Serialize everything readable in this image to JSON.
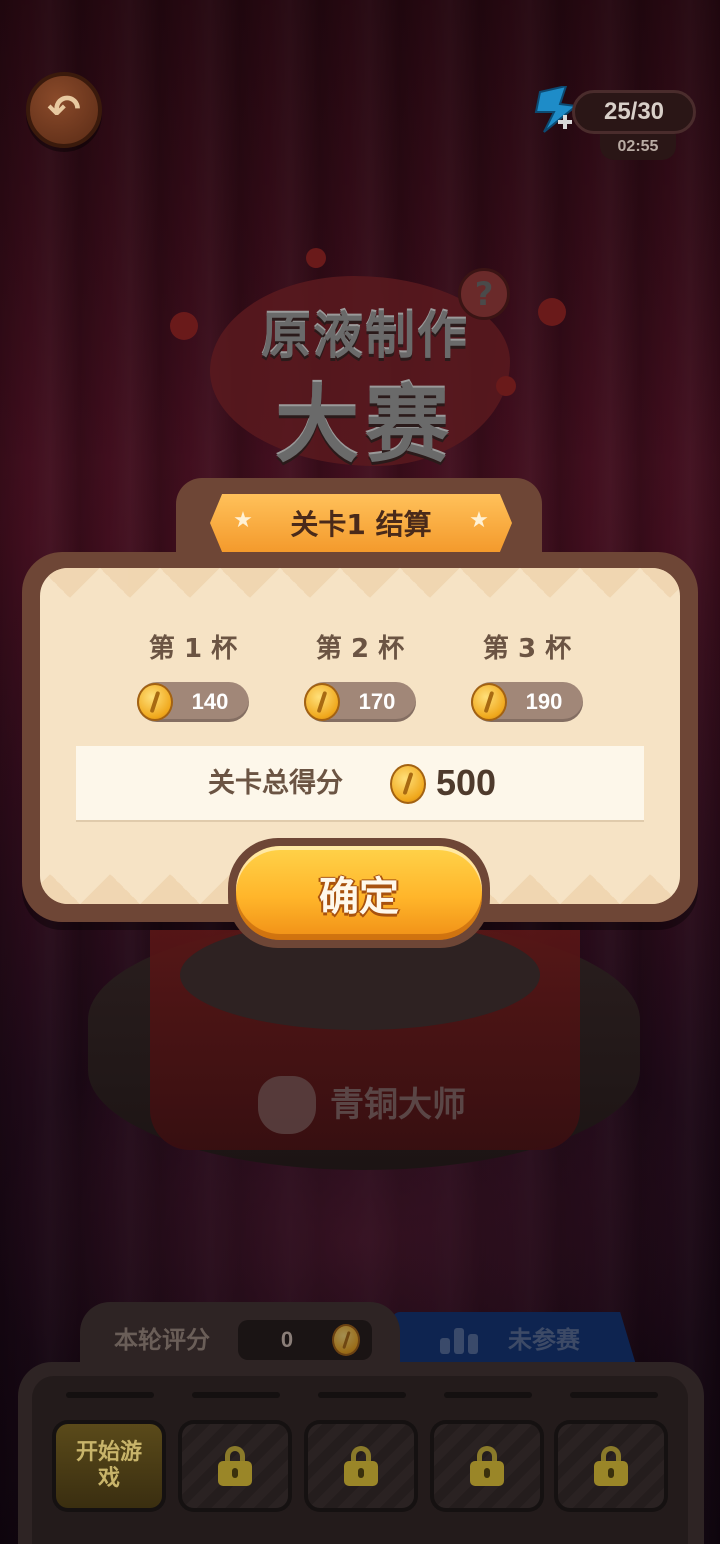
{
  "top_bar": {
    "energy": "25/30",
    "timer": "02:55"
  },
  "logo": {
    "line1": "原液制作",
    "line2": "大赛",
    "help_mark": "?"
  },
  "result": {
    "title": "关卡1 结算",
    "cups": [
      {
        "label": "第 1 杯",
        "score": "140"
      },
      {
        "label": "第 2 杯",
        "score": "170"
      },
      {
        "label": "第 3 杯",
        "score": "190"
      }
    ],
    "total_label": "关卡总得分",
    "total_value": "500",
    "confirm_label": "确定"
  },
  "pedestal": {
    "rank_label": "青铜大师"
  },
  "bottom_panel": {
    "score_tab_label": "本轮评分",
    "score_value": "0",
    "rank_tab_label": "未参赛",
    "start_slot_label": "开始游戏",
    "locked_slots": 4
  },
  "colors": {
    "accent_orange": "#ffb52a",
    "dialog_frame": "#6e4636",
    "dialog_body": "#f6e3c5",
    "rank_tab": "#0e2450"
  }
}
